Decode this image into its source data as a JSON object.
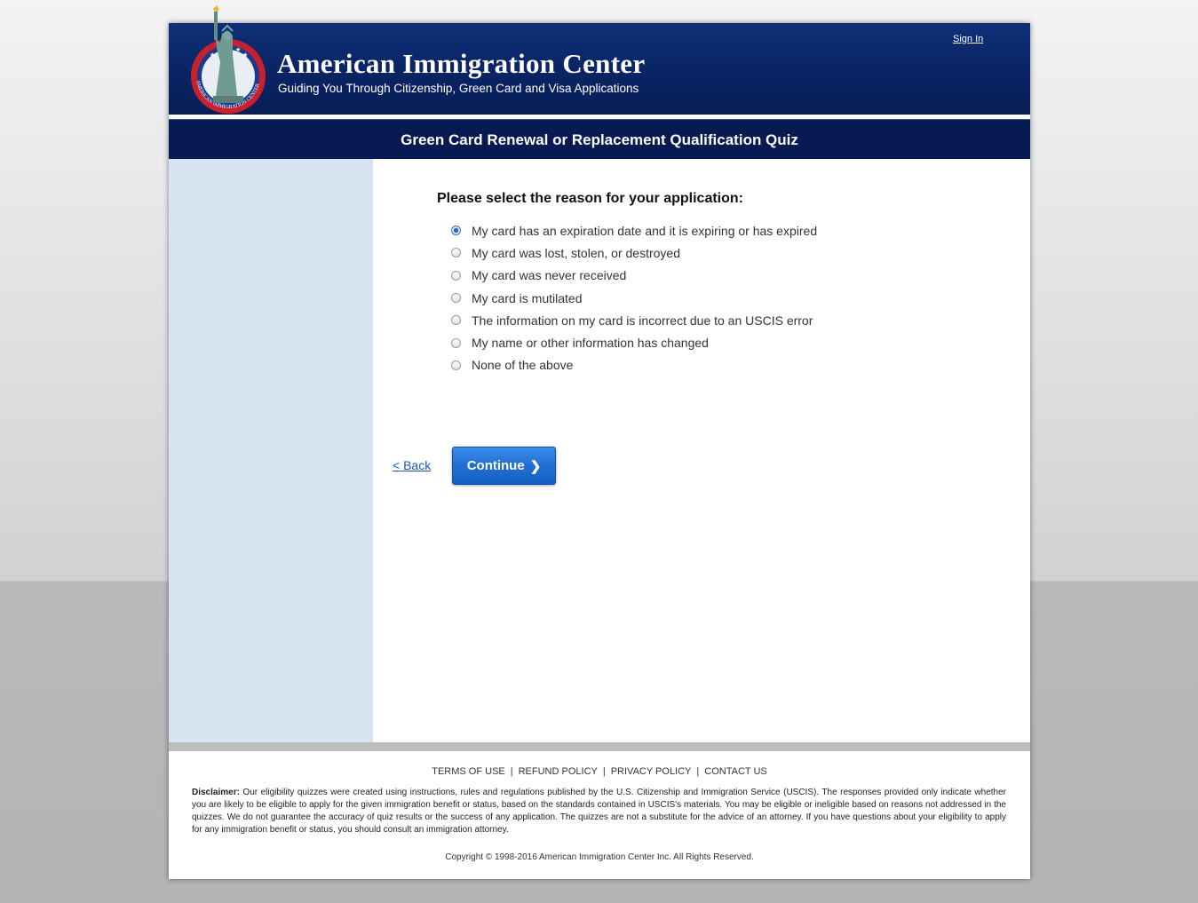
{
  "header": {
    "site_title": "American Immigration Center",
    "tagline": "Guiding You Through Citizenship, Green Card and Visa Applications",
    "logo_ring_text": "AMERICAN IMMIGRATION CENTER",
    "sign_in": "Sign In"
  },
  "quiz": {
    "title": "Green Card Renewal or Replacement Qualification Quiz",
    "question": "Please select the reason for your application:",
    "options": [
      {
        "label": "My card has an expiration date and it is expiring or has expired",
        "selected": true
      },
      {
        "label": "My card was lost, stolen, or destroyed",
        "selected": false
      },
      {
        "label": "My card was never received",
        "selected": false
      },
      {
        "label": "My card is mutilated",
        "selected": false
      },
      {
        "label": "The information on my card is incorrect due to an USCIS error",
        "selected": false
      },
      {
        "label": "My name or other information has changed",
        "selected": false
      },
      {
        "label": "None of the above",
        "selected": false
      }
    ],
    "back_label": "< Back",
    "continue_label": "Continue"
  },
  "footer": {
    "links": [
      "TERMS OF USE",
      "REFUND POLICY",
      "PRIVACY POLICY",
      "CONTACT US"
    ],
    "disclaimer_label": "Disclaimer:",
    "disclaimer_text": "Our eligibility quizzes were created using instructions, rules and regulations published by the U.S. Citizenship and Immigration Service (USCIS). The responses provided only indicate whether you are likely to be eligible to apply for the given immigration benefit or status, based on the standards contained in USCIS's materials. You may be eligible or ineligible based on reasons not addressed in the quizzes. We do not guarantee the accuracy of quiz results or the success of any application. The quizzes are not a substitute for the advice of an attorney. If you have questions about your eligibility to apply for any immigration benefit or status, you should consult an immigration attorney.",
    "copyright": "Copyright © 1998-2016 American Immigration Center Inc. All Rights Reserved."
  },
  "colors": {
    "header_navy": "#0a2668",
    "title_bar": "#071b52",
    "sidebar": "#d8e4f1",
    "button_blue": "#1f6fd3",
    "link_blue": "#1f57b5",
    "logo_red": "#c8202f"
  }
}
